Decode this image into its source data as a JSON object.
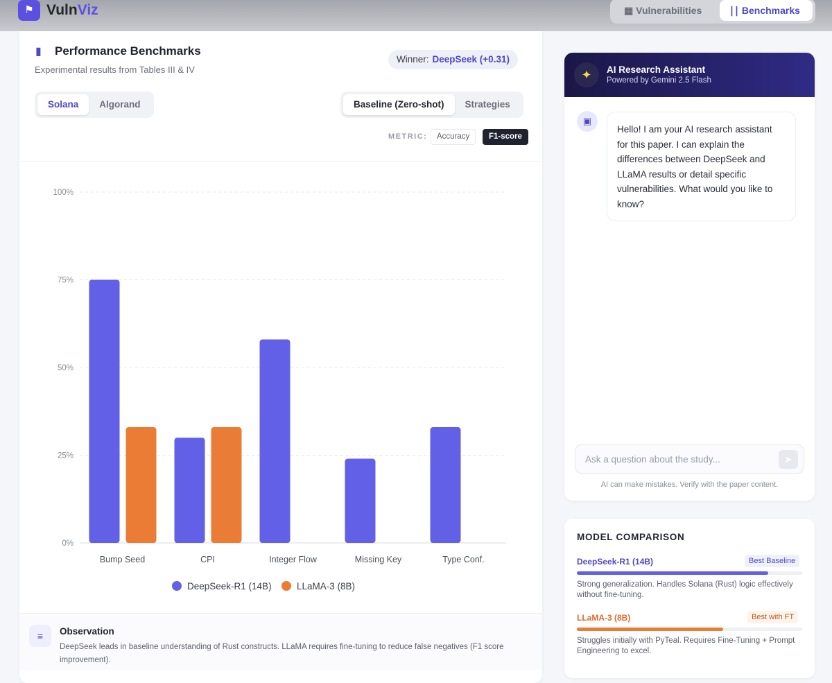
{
  "app": {
    "name_a": "Vuln",
    "name_b": "Viz",
    "nav": [
      {
        "label": "Vulnerabilities",
        "active": false
      },
      {
        "label": "Benchmarks",
        "active": true
      }
    ]
  },
  "panel": {
    "title": "Performance Benchmarks",
    "subtitle": "Experimental results from Tables III & IV",
    "winner_label": "Winner:",
    "winner_value": "DeepSeek (+0.31)",
    "chains": [
      "Solana",
      "Algorand"
    ],
    "modes": [
      "Baseline (Zero-shot)",
      "Strategies"
    ],
    "metric_label": "METRIC:",
    "metrics": [
      "Accuracy",
      "F1-score"
    ],
    "observation_title": "Observation",
    "observation_text": "DeepSeek leads in baseline understanding of Rust constructs. LLaMA requires fine-tuning to reduce false negatives (F1 score improvement)."
  },
  "chart_data": {
    "type": "bar",
    "categories": [
      "Bump Seed",
      "CPI",
      "Integer Flow",
      "Missing Key",
      "Type Conf."
    ],
    "series": [
      {
        "name": "DeepSeek-R1 (14B)",
        "color": "#6260e6",
        "values": [
          75,
          30,
          58,
          24,
          33
        ]
      },
      {
        "name": "LLaMA-3 (8B)",
        "color": "#ea7c35",
        "values": [
          33,
          33,
          0,
          0,
          0
        ]
      }
    ],
    "yticks": [
      "0%",
      "25%",
      "50%",
      "75%",
      "100%"
    ],
    "ylim": [
      0,
      100
    ],
    "ylabel": "",
    "xlabel": "",
    "legend": "bottom",
    "grid": true
  },
  "assistant": {
    "title": "AI Research Assistant",
    "subtitle": "Powered by Gemini 2.5 Flash",
    "message": "Hello! I am your AI research assistant for this paper. I can explain the differences between DeepSeek and LLaMA results or detail specific vulnerabilities. What would you like to know?",
    "placeholder": "Ask a question about the study...",
    "disclaimer": "AI can make mistakes. Verify with the paper content."
  },
  "comparison": {
    "title": "MODEL COMPARISON",
    "models": [
      {
        "name": "DeepSeek-R1 (14B)",
        "badge": "Best Baseline",
        "score": 0.85,
        "desc": "Strong generalization. Handles Solana (Rust) logic effectively without fine-tuning."
      },
      {
        "name": "LLaMA-3 (8B)",
        "badge": "Best with FT",
        "score": 0.65,
        "desc": "Struggles initially with PyTeal. Requires Fine-Tuning + Prompt Engineering to excel."
      }
    ]
  }
}
